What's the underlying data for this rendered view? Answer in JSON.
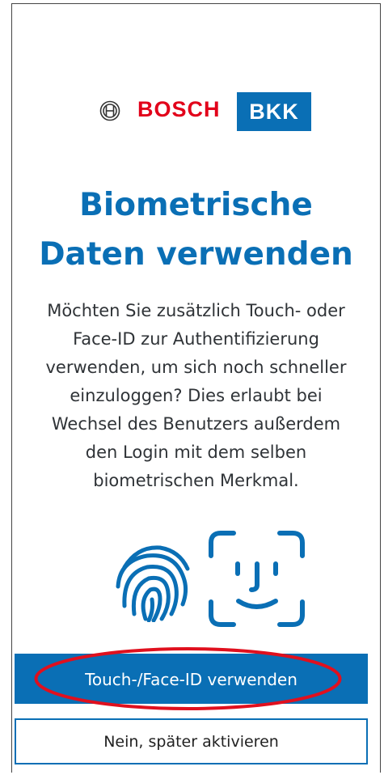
{
  "logo": {
    "bosch_text": "BOSCH",
    "bkk_text": "BKK"
  },
  "title": {
    "line1": "Biometrische",
    "line2": "Daten verwenden"
  },
  "description": {
    "lines": [
      "Möchten Sie zusätzlich Touch- oder",
      "Face-ID zur Authentifizierung",
      "verwenden, um sich noch schneller",
      "einzuloggen? Dies erlaubt bei",
      "Wechsel des Benutzers außerdem",
      "den Login mit dem selben",
      "biometrischen Merkmal."
    ]
  },
  "icons": {
    "fingerprint": "fingerprint-icon",
    "face_id": "face-id-icon"
  },
  "buttons": {
    "primary_label": "Touch-/Face-ID verwenden",
    "secondary_label": "Nein, später aktivieren"
  },
  "colors": {
    "brand_blue": "#0a6fb5",
    "bosch_red": "#e2001a",
    "highlight_red": "#e0101e",
    "text_dark": "#2f3337"
  }
}
